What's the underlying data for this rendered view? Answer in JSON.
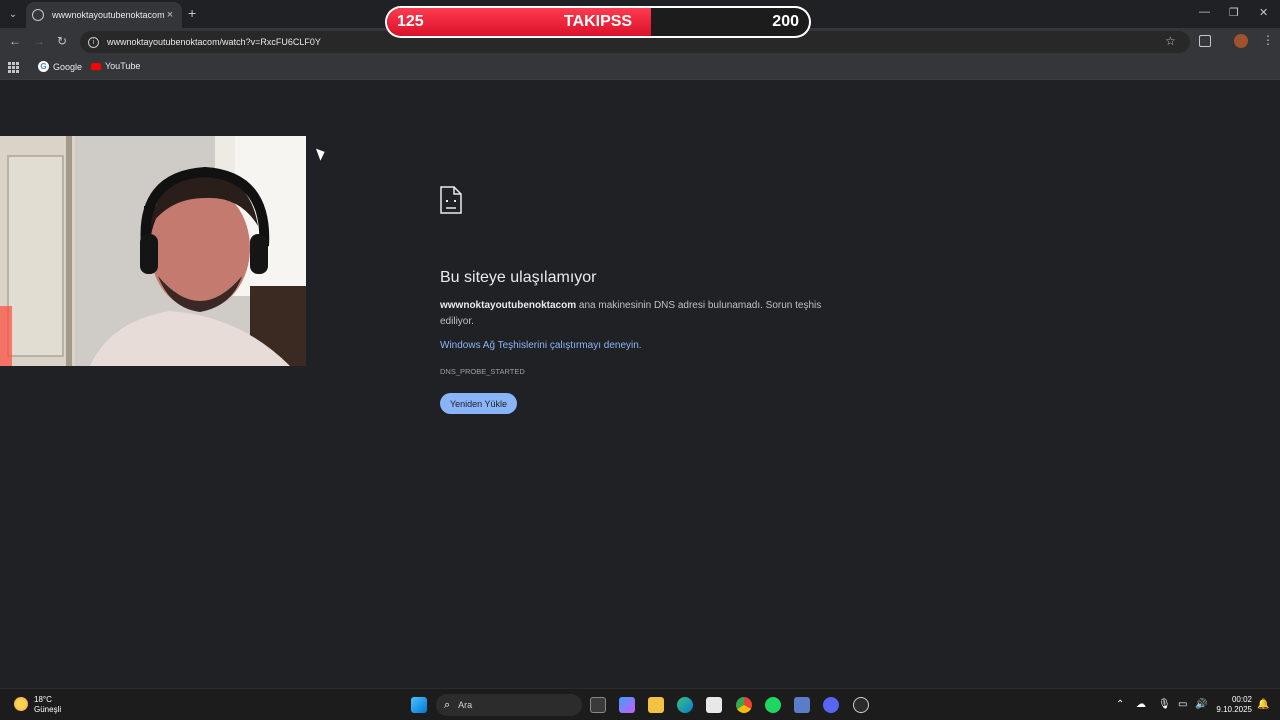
{
  "browser": {
    "tab_title": "wwwnoktayoutubenoktacom",
    "url": "wwwnoktayoutubenoktacom/watch?v=RxcFU6CLF0Y",
    "bookmarks": [
      {
        "label": "Google"
      },
      {
        "label": "YouTube"
      }
    ]
  },
  "follower_goal": {
    "current": "125",
    "label": "TAKIPSS",
    "goal": "200",
    "progress": 0.625,
    "fill_color": "#e8182f"
  },
  "error_page": {
    "title": "Bu siteye ulaşılamıyor",
    "host": "wwwnoktayoutubenoktacom",
    "description": " ana makinesinin DNS adresi bulunamadı. Sorun teşhis ediliyor.",
    "diagnostics_link": "Windows Ağ Teşhislerini çalıştırmayı deneyin.",
    "error_code": "DNS_PROBE_STARTED",
    "reload_button": "Yeniden Yükle"
  },
  "taskbar": {
    "weather_temp": "18°C",
    "weather_desc": "Güneşli",
    "search_placeholder": "Ara",
    "time": "00:02",
    "date": "9.10.2025"
  }
}
